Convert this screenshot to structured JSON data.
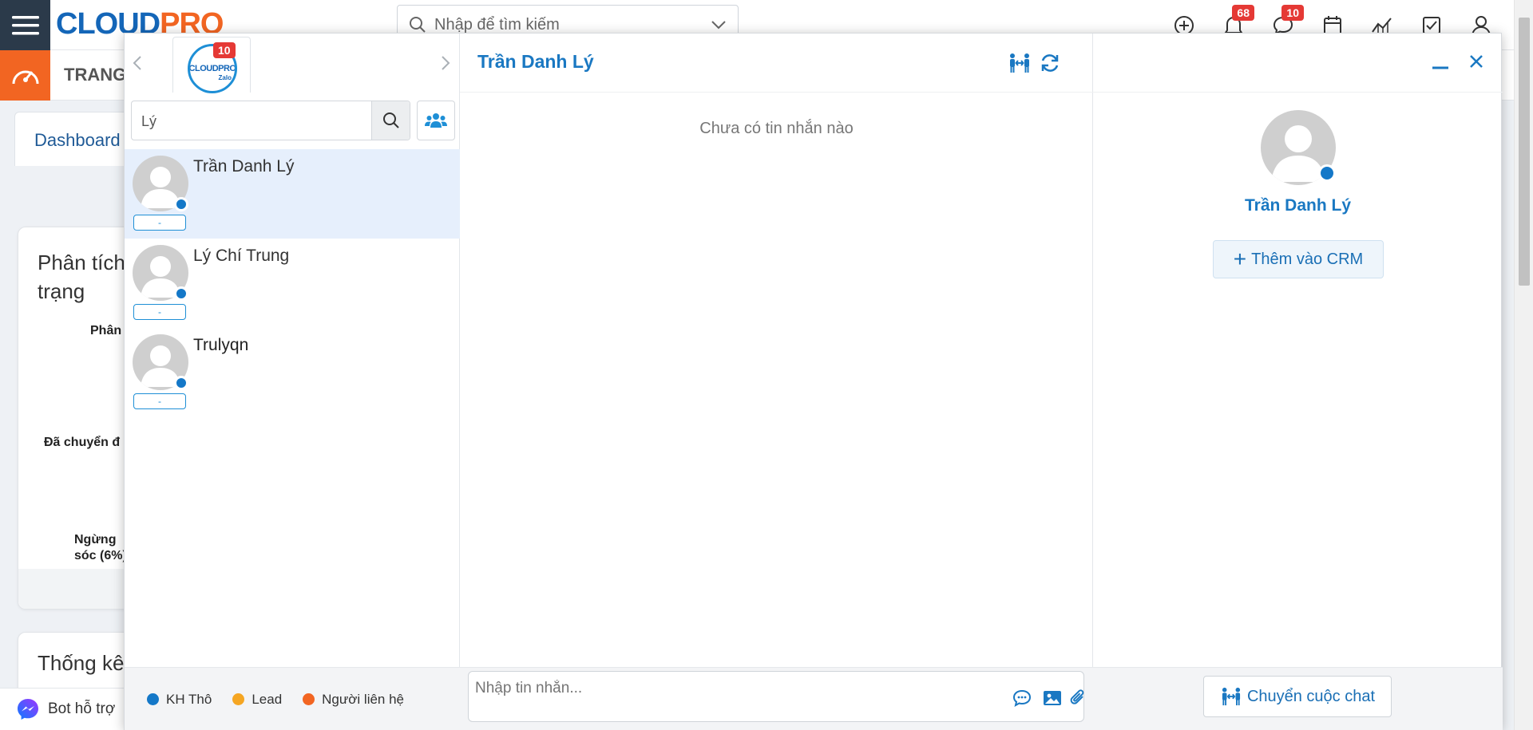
{
  "topbar": {
    "logo": {
      "main": "CLOUD",
      "accent": "PRO"
    },
    "search_placeholder": "Nhập để tìm kiếm",
    "notification_count": "68",
    "message_count": "10"
  },
  "subbar": {
    "module_title": "TRANG"
  },
  "dashboard_tab": "Dashboard",
  "background_cards": {
    "card1_title": "Phân tích\ntrạng",
    "label_1": "Phân",
    "label_2": "Đã chuyển đ",
    "label_3": "Ngừng\nsóc (6%)",
    "card2_title": "Thống kê"
  },
  "bot_bar": {
    "label": "Bot hỗ trợ"
  },
  "chat": {
    "account": {
      "badge": "10",
      "logo_text": "CLOUDPRO",
      "zalo_text": "Zalo"
    },
    "search": {
      "value": "Lý"
    },
    "contacts": [
      {
        "name": "Trần Danh Lý",
        "tag": "-",
        "active": true
      },
      {
        "name": "Lý Chí Trung",
        "tag": "-",
        "active": false
      },
      {
        "name": "Trulyqn",
        "tag": "-",
        "active": false
      }
    ],
    "legend": [
      {
        "label": "KH Thô",
        "color": "#1478c8"
      },
      {
        "label": "Lead",
        "color": "#f5a623"
      },
      {
        "label": "Người liên hệ",
        "color": "#f26522"
      }
    ],
    "conversation": {
      "title": "Trần Danh Lý",
      "empty_text": "Chưa có tin nhắn nào",
      "composer_placeholder": "Nhập tin nhắn..."
    },
    "profile": {
      "name": "Trần Danh Lý",
      "add_crm_label": "Thêm vào CRM",
      "transfer_label": "Chuyển cuộc chat"
    }
  }
}
